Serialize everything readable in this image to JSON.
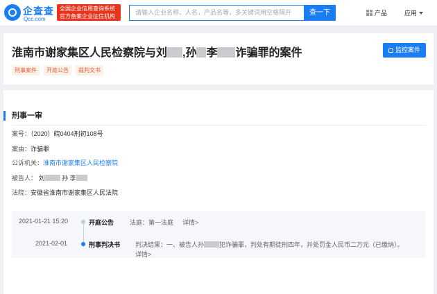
{
  "header": {
    "logo_cn": "企查查",
    "logo_en": "Qcc.com",
    "cert_line1": "全国企业信用查询系统",
    "cert_line2": "官方备案企业征信机构",
    "search_placeholder": "请输入企业名称、人名，产品名等，多关键词用空格隔开",
    "search_button": "查一下",
    "nav_product": "产品",
    "nav_app": "应用"
  },
  "case": {
    "title_part1": "淮南市谢家集区人民检察院与刘",
    "title_part2": ",孙",
    "title_part3": "李",
    "title_part4": "诈骗罪的案件",
    "tags": [
      "刑事案件",
      "开庭公告",
      "裁判文书"
    ],
    "monitor_label": "监控案件"
  },
  "section": {
    "title": "刑事一审",
    "case_no_label": "案号：",
    "case_no": "（2020）皖0404刑初108号",
    "cause_label": "案由：",
    "cause": "诈骗罪",
    "prosecutor_label": "公诉机关：",
    "prosecutor": "淮南市谢家集区人民检察院",
    "defendant_label": "被告人：",
    "defendant_1": "刘",
    "defendant_2": "孙",
    "defendant_3": "李",
    "court_label": "法院：",
    "court": "安徽省淮南市谢家集区人民法院"
  },
  "timeline": [
    {
      "date": "2021-01-21 15:20",
      "type": "开庭公告",
      "info_label": "法庭：",
      "info": "第一法庭",
      "detail": "详情>"
    },
    {
      "date": "2021-02-01",
      "type": "刑事判决书",
      "info_label": "判决结果：",
      "info_a": "一、被告人孙",
      "info_b": "犯诈骗罪，判处有期徒刑四年，并处罚金人民币二万元（已缴纳）。",
      "detail": "详情>"
    }
  ]
}
